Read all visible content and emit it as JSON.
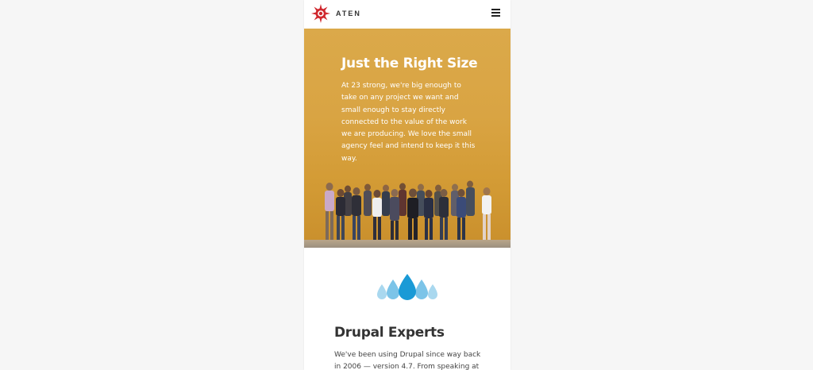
{
  "header": {
    "logo_text": "ATEN",
    "menu_icon": "hamburger-menu-icon"
  },
  "hero": {
    "title": "Just the Right Size",
    "body": "At 23 strong, we're big enough to take on any project we want and small enough to stay directly connected to the value of the work we are producing. We love the small agency feel and intend to keep it this way.",
    "background_color": "#d9a443"
  },
  "drupal": {
    "icon": "drupal-drops-icon",
    "title": "Drupal Experts",
    "body": "We've been using Drupal since way back in 2006 — version 4.7. From speaking at"
  },
  "colors": {
    "accent_red": "#d0282e",
    "drop_blue": "#1a9ad6",
    "drop_light_blue": "#a9d8ef"
  }
}
